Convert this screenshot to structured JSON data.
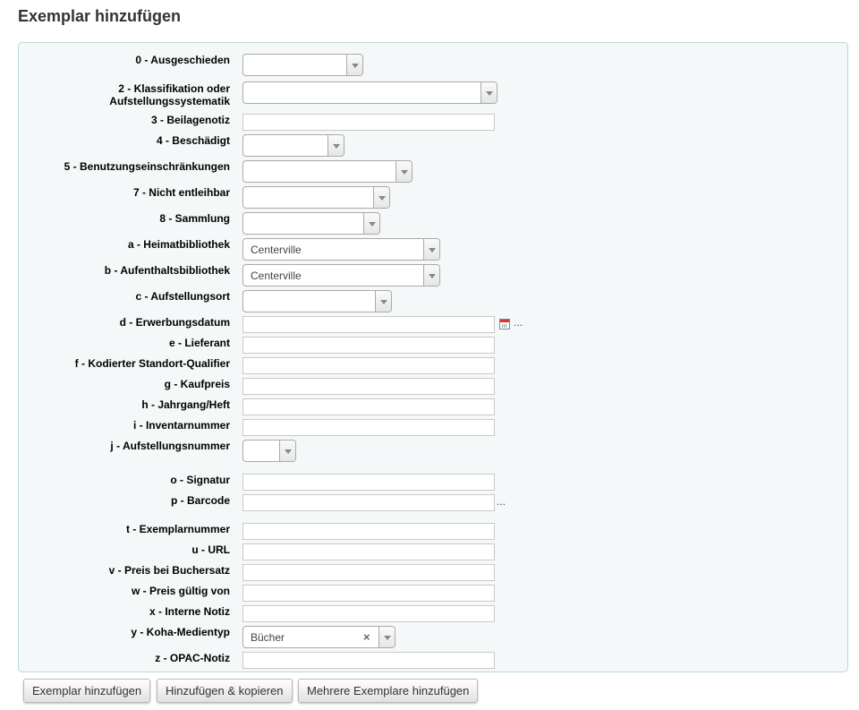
{
  "page": {
    "title": "Exemplar hinzufügen"
  },
  "fields": {
    "f0": {
      "label": "0 - Ausgeschieden",
      "value": ""
    },
    "f2": {
      "label": "2 - Klassifikation oder Aufstellungssystematik",
      "value": ""
    },
    "f3": {
      "label": "3 - Beilagenotiz",
      "value": ""
    },
    "f4": {
      "label": "4 - Beschädigt",
      "value": ""
    },
    "f5": {
      "label": "5 - Benutzungseinschränkungen",
      "value": ""
    },
    "f7": {
      "label": "7 - Nicht entleihbar",
      "value": ""
    },
    "f8": {
      "label": "8 - Sammlung",
      "value": ""
    },
    "fa": {
      "label": "a - Heimatbibliothek",
      "value": "Centerville"
    },
    "fb": {
      "label": "b - Aufenthaltsbibliothek",
      "value": "Centerville"
    },
    "fc": {
      "label": "c - Aufstellungsort",
      "value": ""
    },
    "fd": {
      "label": "d - Erwerbungsdatum",
      "value": "",
      "more": "..."
    },
    "fe": {
      "label": "e - Lieferant",
      "value": ""
    },
    "ff": {
      "label": "f - Kodierter Standort-Qualifier",
      "value": ""
    },
    "fg": {
      "label": "g - Kaufpreis",
      "value": ""
    },
    "fh": {
      "label": "h - Jahrgang/Heft",
      "value": ""
    },
    "fi": {
      "label": "i - Inventarnummer",
      "value": ""
    },
    "fj": {
      "label": "j - Aufstellungsnummer",
      "value": ""
    },
    "fo": {
      "label": "o - Signatur",
      "value": ""
    },
    "fp": {
      "label": "p - Barcode",
      "value": "",
      "more": "..."
    },
    "ft": {
      "label": "t - Exemplarnummer",
      "value": ""
    },
    "fu": {
      "label": "u - URL",
      "value": ""
    },
    "fv": {
      "label": "v - Preis bei Buchersatz",
      "value": ""
    },
    "fw": {
      "label": "w - Preis gültig von",
      "value": ""
    },
    "fx": {
      "label": "x - Interne Notiz",
      "value": ""
    },
    "fy": {
      "label": "y - Koha-Medientyp",
      "value": "Bücher",
      "clear": "×"
    },
    "fz": {
      "label": "z - OPAC-Notiz",
      "value": ""
    }
  },
  "buttons": {
    "add": "Exemplar hinzufügen",
    "add_copy": "Hinzufügen & kopieren",
    "add_multiple": "Mehrere Exemplare hinzufügen"
  },
  "icons": {
    "calendar": "calendar-icon",
    "dropdown": "chevron-down-icon",
    "clear": "clear-icon"
  }
}
